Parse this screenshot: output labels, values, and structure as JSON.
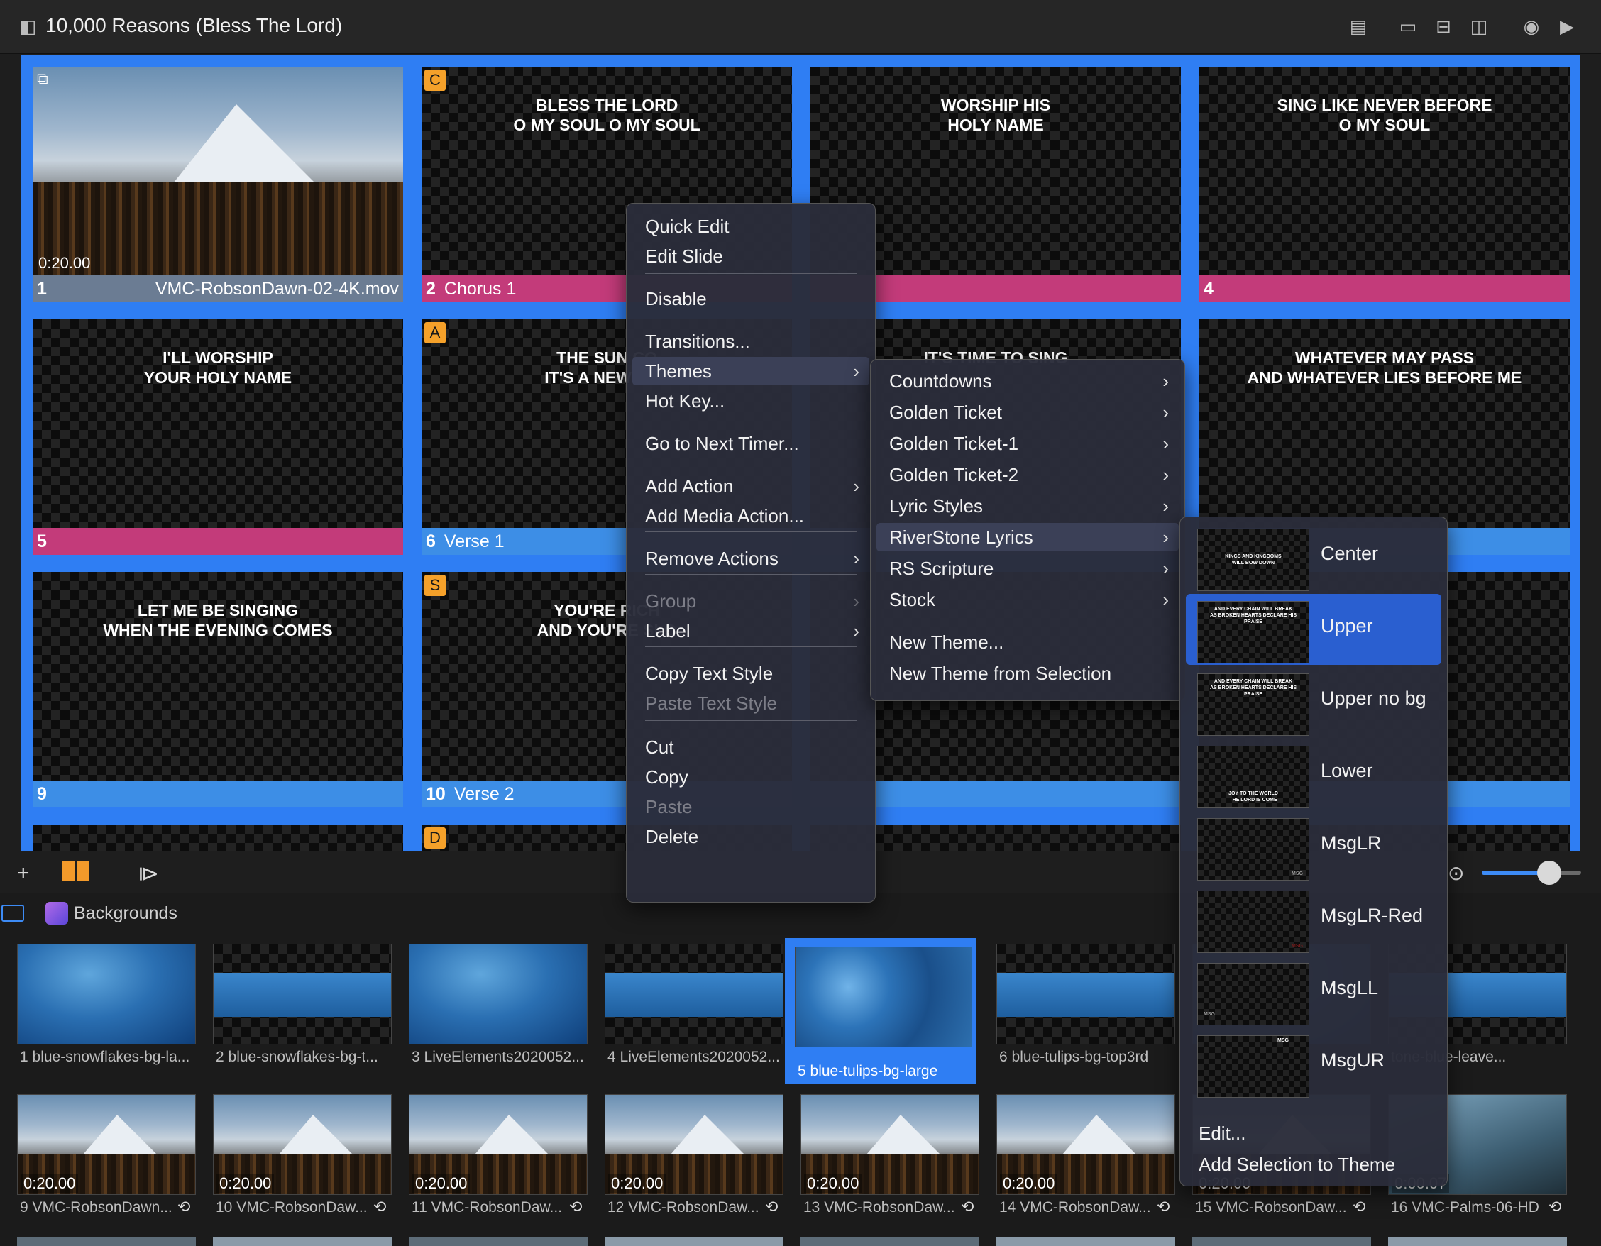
{
  "window": {
    "title": "10,000 Reasons (Bless The Lord)"
  },
  "slides": [
    {
      "num": "1",
      "label": "",
      "file": "VMC-RobsonDawn-02-4K.mov",
      "duration": "0:20.00",
      "lyrics": "",
      "bar_color": "#6b7c93",
      "badge": ""
    },
    {
      "num": "2",
      "label": "Chorus 1",
      "file": "",
      "duration": "",
      "lyrics": "BLESS THE LORD\nO MY SOUL O MY SOUL",
      "bar_color": "#c33b7a",
      "badge": "C"
    },
    {
      "num": "",
      "label": "",
      "file": "",
      "duration": "",
      "lyrics": "WORSHIP HIS\nHOLY NAME",
      "bar_color": "#c33b7a",
      "badge": ""
    },
    {
      "num": "4",
      "label": "",
      "file": "",
      "duration": "",
      "lyrics": "SING LIKE NEVER BEFORE\nO MY SOUL",
      "bar_color": "#c33b7a",
      "badge": ""
    },
    {
      "num": "5",
      "label": "",
      "file": "",
      "duration": "",
      "lyrics": "I'LL WORSHIP\nYOUR HOLY NAME",
      "bar_color": "#c33b7a",
      "badge": ""
    },
    {
      "num": "6",
      "label": "Verse 1",
      "file": "",
      "duration": "",
      "lyrics": "THE SUN CO\nIT'S A NEW DAY",
      "bar_color": "#3d8ee6",
      "badge": "A"
    },
    {
      "num": "",
      "label": "",
      "file": "",
      "duration": "",
      "lyrics": "IT'S TIME TO SING",
      "bar_color": "#3d8ee6",
      "badge": ""
    },
    {
      "num": "",
      "label": "",
      "file": "",
      "duration": "",
      "lyrics": "WHATEVER MAY PASS\nAND WHATEVER LIES BEFORE ME",
      "bar_color": "#3d8ee6",
      "badge": ""
    },
    {
      "num": "9",
      "label": "",
      "file": "",
      "duration": "",
      "lyrics": "LET ME BE SINGING\nWHEN THE EVENING COMES",
      "bar_color": "#3d8ee6",
      "badge": ""
    },
    {
      "num": "10",
      "label": "Verse 2",
      "file": "",
      "duration": "",
      "lyrics": "YOU'RE RICH\nAND YOU'RE SLO",
      "bar_color": "#3d8ee6",
      "badge": "S"
    },
    {
      "num": "",
      "label": "",
      "file": "",
      "duration": "",
      "lyrics": "",
      "bar_color": "#3d8ee6",
      "badge": ""
    },
    {
      "num": "",
      "label": "",
      "file": "",
      "duration": "",
      "lyrics": "NESS\nING",
      "bar_color": "#3d8ee6",
      "badge": ""
    }
  ],
  "row4_badge": "D",
  "backgrounds": {
    "label": "Backgrounds",
    "row1": [
      {
        "caption": "1 blue-snowflakes-bg-la...",
        "kind": "blue",
        "selected": false
      },
      {
        "caption": "2 blue-snowflakes-bg-t...",
        "kind": "strip",
        "selected": false
      },
      {
        "caption": "3 LiveElements2020052...",
        "kind": "blue",
        "selected": false
      },
      {
        "caption": "4 LiveElements2020052...",
        "kind": "strip",
        "selected": false
      },
      {
        "caption": "5 blue-tulips-bg-large",
        "kind": "tulips",
        "selected": true
      },
      {
        "caption": "6 blue-tulips-bg-top3rd",
        "kind": "strip",
        "selected": false
      },
      {
        "caption": "",
        "kind": "blue",
        "selected": false
      },
      {
        "caption": "tone-blue-leave...",
        "kind": "strip",
        "selected": false
      }
    ],
    "row2": [
      {
        "caption": "9 VMC-RobsonDawn...",
        "duration": "0:20.00"
      },
      {
        "caption": "10 VMC-RobsonDaw...",
        "duration": "0:20.00"
      },
      {
        "caption": "11 VMC-RobsonDaw...",
        "duration": "0:20.00"
      },
      {
        "caption": "12 VMC-RobsonDaw...",
        "duration": "0:20.00"
      },
      {
        "caption": "13 VMC-RobsonDaw...",
        "duration": "0:20.00"
      },
      {
        "caption": "14 VMC-RobsonDaw...",
        "duration": "0:20.00"
      },
      {
        "caption": "15 VMC-RobsonDaw...",
        "duration": "0:20.00"
      },
      {
        "caption": "16 VMC-Palms-06-HD",
        "duration": "0:00.07"
      }
    ]
  },
  "context_menu": {
    "items": [
      {
        "label": "Quick Edit"
      },
      {
        "label": "Edit Slide"
      },
      {
        "label": "Disable"
      },
      {
        "label": "Transitions..."
      },
      {
        "label": "Themes"
      },
      {
        "label": "Hot Key..."
      },
      {
        "label": "Go to Next Timer..."
      },
      {
        "label": "Add Action"
      },
      {
        "label": "Add Media Action..."
      },
      {
        "label": "Remove Actions"
      },
      {
        "label": "Group"
      },
      {
        "label": "Label"
      },
      {
        "label": "Copy Text Style"
      },
      {
        "label": "Paste Text Style"
      },
      {
        "label": "Cut"
      },
      {
        "label": "Copy"
      },
      {
        "label": "Paste"
      },
      {
        "label": "Delete"
      }
    ]
  },
  "themes_menu": {
    "items": [
      {
        "label": "Countdowns"
      },
      {
        "label": "Golden Ticket"
      },
      {
        "label": "Golden Ticket-1"
      },
      {
        "label": "Golden Ticket-2"
      },
      {
        "label": "Lyric Styles"
      },
      {
        "label": "RiverStone Lyrics"
      },
      {
        "label": "RS Scripture"
      },
      {
        "label": "Stock"
      },
      {
        "label": "New Theme..."
      },
      {
        "label": "New Theme from Selection"
      }
    ]
  },
  "riverstone_menu": {
    "items": [
      {
        "label": "Center",
        "preview": "KINGS AND KINGDOMS\nWILL BOW DOWN",
        "pos": "center"
      },
      {
        "label": "Upper",
        "preview": "AND EVERY CHAIN WILL BREAK\nAS BROKEN HEARTS DECLARE HIS\nPRAISE",
        "pos": "top"
      },
      {
        "label": "Upper no bg",
        "preview": "AND EVERY CHAIN WILL BREAK\nAS BROKEN HEARTS DECLARE HIS\nPRAISE",
        "pos": "top"
      },
      {
        "label": "Lower",
        "preview": "JOY TO THE WORLD\nTHE LORD IS COME",
        "pos": "bottom"
      },
      {
        "label": "MsgLR",
        "preview": "MSG",
        "pos": "br"
      },
      {
        "label": "MsgLR-Red",
        "preview": "MSG",
        "pos": "br-red"
      },
      {
        "label": "MsgLL",
        "preview": "MSG",
        "pos": "bl"
      },
      {
        "label": "MsgUR",
        "preview": "MSG",
        "pos": "tr"
      }
    ],
    "edit_label": "Edit...",
    "add_label": "Add Selection to Theme"
  },
  "colors": {
    "accent": "#2f7ef3",
    "chorus": "#c33b7a",
    "verse": "#3d8ee6",
    "badge": "#f5a12a"
  },
  "icons": [
    "presentation-icon",
    "display-icon",
    "stage-icon",
    "props-icon",
    "record-icon",
    "play-icon",
    "add-icon",
    "grid-view-icon",
    "sidebar-icon"
  ]
}
